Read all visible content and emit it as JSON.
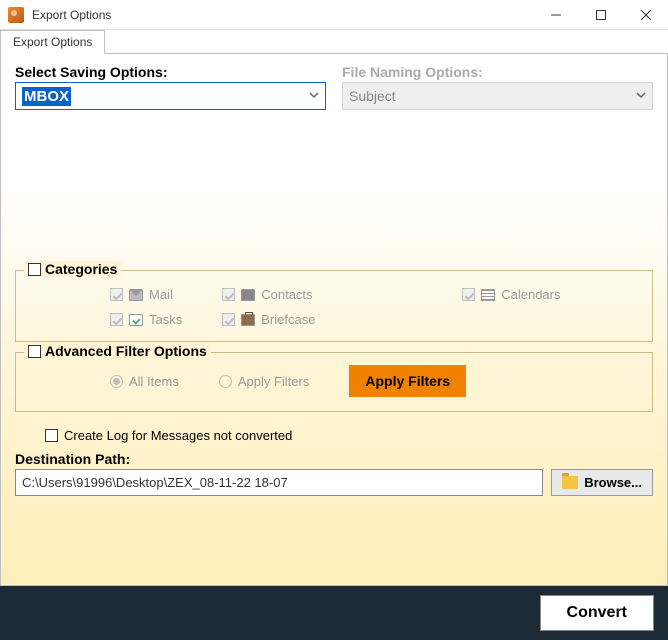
{
  "window": {
    "title": "Export Options"
  },
  "tab": {
    "label": "Export Options"
  },
  "saving": {
    "label": "Select Saving Options:",
    "value": "MBOX"
  },
  "naming": {
    "label": "File Naming Options:",
    "value": "Subject"
  },
  "categories": {
    "legend": "Categories",
    "mail": "Mail",
    "tasks": "Tasks",
    "contacts": "Contacts",
    "briefcase": "Briefcase",
    "calendars": "Calendars"
  },
  "filters": {
    "legend": "Advanced Filter Options",
    "all_items": "All Items",
    "apply_radio": "Apply Filters",
    "apply_btn": "Apply Filters"
  },
  "log": {
    "label": "Create Log for Messages not converted"
  },
  "destination": {
    "label": "Destination Path:",
    "value": "C:\\Users\\91996\\Desktop\\ZEX_08-11-22 18-07",
    "browse": "Browse..."
  },
  "footer": {
    "convert": "Convert"
  }
}
